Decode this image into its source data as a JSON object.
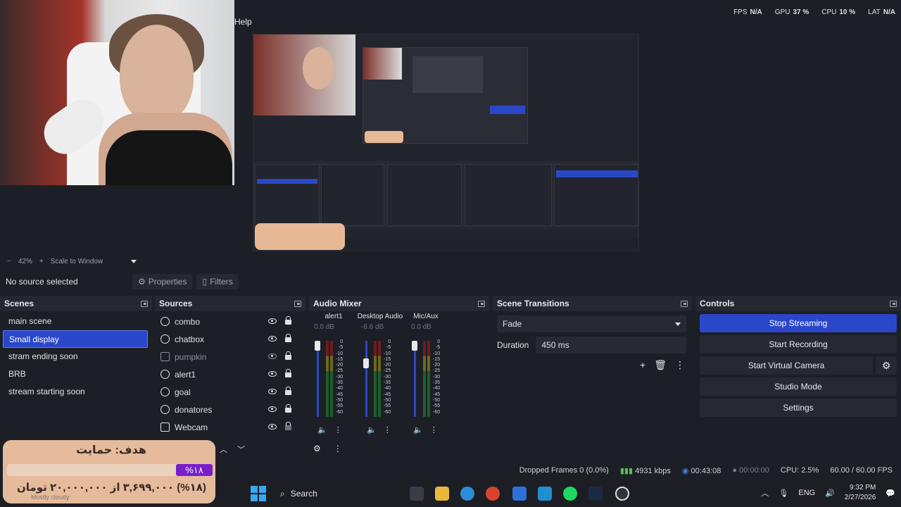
{
  "menu": {
    "help": "Help"
  },
  "stats": [
    {
      "label": "FPS",
      "value": "N/A"
    },
    {
      "label": "GPU",
      "value": "37 %"
    },
    {
      "label": "CPU",
      "value": "10 %"
    },
    {
      "label": "LAT",
      "value": "N/A"
    }
  ],
  "zoom": {
    "level": "42%",
    "mode": "Scale to Window"
  },
  "source_toolbar": {
    "no_source": "No source selected",
    "properties": "Properties",
    "filters": "Filters"
  },
  "scenes": {
    "title": "Scenes",
    "items": [
      "main scene",
      "Small display",
      "stram ending soon",
      "BRB",
      "stream starting soon"
    ],
    "selected_index": 1
  },
  "sources": {
    "title": "Sources",
    "items": [
      {
        "name": "combo",
        "icon": "globe-icon",
        "visible": true
      },
      {
        "name": "chatbox",
        "icon": "globe-icon",
        "visible": true
      },
      {
        "name": "pumpkin",
        "icon": "image-icon",
        "visible": false
      },
      {
        "name": "alert1",
        "icon": "globe-icon",
        "visible": true
      },
      {
        "name": "goal",
        "icon": "globe-icon",
        "visible": true
      },
      {
        "name": "donatores",
        "icon": "globe-icon",
        "visible": true
      },
      {
        "name": "Webcam",
        "icon": "camera-icon",
        "visible": true
      }
    ]
  },
  "mixer": {
    "title": "Audio Mixer",
    "channels": [
      {
        "name": "alert1",
        "db": "0.0 dB"
      },
      {
        "name": "Desktop Audio",
        "db": "-6.6 dB"
      },
      {
        "name": "Mic/Aux",
        "db": "0.0 dB"
      }
    ],
    "scale": [
      "0",
      "-5",
      "-10",
      "-15",
      "-20",
      "-25",
      "-30",
      "-35",
      "-40",
      "-45",
      "-50",
      "-55",
      "-60"
    ]
  },
  "transitions": {
    "title": "Scene Transitions",
    "selected": "Fade",
    "duration_label": "Duration",
    "duration_value": "450 ms"
  },
  "controls": {
    "title": "Controls",
    "stop_streaming": "Stop Streaming",
    "start_recording": "Start Recording",
    "start_virtual_camera": "Start Virtual Camera",
    "studio_mode": "Studio Mode",
    "settings": "Settings"
  },
  "status": {
    "dropped_frames": "Dropped Frames 0 (0.0%)",
    "bitrate": "4931 kbps",
    "stream_time": "00:43:08",
    "rec_time": "00:00:00",
    "cpu": "CPU: 2.5%",
    "fps": "60.00 / 60.00 FPS"
  },
  "taskbar": {
    "search": "Search",
    "language": "ENG",
    "time": "9:32 PM",
    "date": "2/27/2026"
  },
  "goal_widget": {
    "title": "هدف: حمایت",
    "percent": "%۱۸",
    "amount": "(%۱۸) ۳,۶۹۹,۰۰۰ از ۲۰,۰۰۰,۰۰۰ تومان",
    "weather": "Mostly cloudy"
  },
  "colors": {
    "accent": "#2b47c9",
    "panel": "#1d1f26",
    "goal_bg": "#f0c4a2",
    "goal_accent": "#7d1fd6"
  }
}
